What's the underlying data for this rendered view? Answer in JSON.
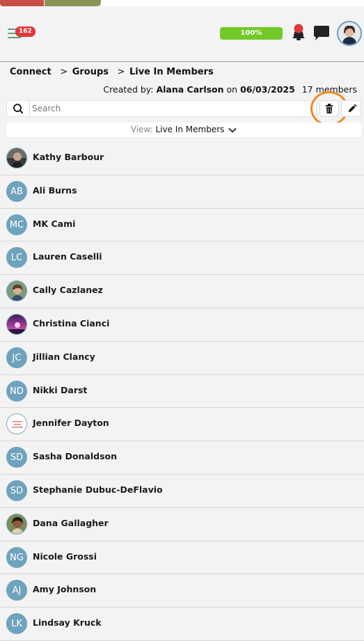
{
  "header": {
    "notification_count": "162",
    "progress_label": "100%",
    "progress_value": 1.0
  },
  "breadcrumb": {
    "items": [
      "Connect",
      "Groups",
      "Live In Members"
    ],
    "separator": ">"
  },
  "group_info": {
    "created_prefix": "Created by:",
    "creator": "Alana Carlson",
    "on_word": "on",
    "date": "06/03/2025",
    "member_count": "17 members"
  },
  "search": {
    "placeholder": "Search"
  },
  "view": {
    "label": "View:",
    "value": "Live In Members"
  },
  "members": [
    {
      "name": "Kathy Barbour",
      "initials": "",
      "avatar": "photo"
    },
    {
      "name": "Ali Burns",
      "initials": "AB",
      "avatar": "initials"
    },
    {
      "name": "MK Cami",
      "initials": "MC",
      "avatar": "initials"
    },
    {
      "name": "Lauren Caselli",
      "initials": "LC",
      "avatar": "initials"
    },
    {
      "name": "Cally Cazlanez",
      "initials": "",
      "avatar": "photo"
    },
    {
      "name": "Christina Cianci",
      "initials": "",
      "avatar": "photo"
    },
    {
      "name": "Jillian Clancy",
      "initials": "JC",
      "avatar": "initials"
    },
    {
      "name": "Nikki Darst",
      "initials": "ND",
      "avatar": "initials"
    },
    {
      "name": "Jennifer Dayton",
      "initials": "",
      "avatar": "logo"
    },
    {
      "name": "Sasha Donaldson",
      "initials": "SD",
      "avatar": "initials"
    },
    {
      "name": "Stephanie Dubuc-DeFlavio",
      "initials": "SD",
      "avatar": "initials"
    },
    {
      "name": "Dana Gallagher",
      "initials": "",
      "avatar": "photo"
    },
    {
      "name": "Nicole Grossi",
      "initials": "NG",
      "avatar": "initials"
    },
    {
      "name": "Amy Johnson",
      "initials": "AJ",
      "avatar": "initials"
    },
    {
      "name": "Lindsay Kruck",
      "initials": "LK",
      "avatar": "initials"
    }
  ],
  "colors": {
    "accent_green": "#72c928",
    "badge_red": "#e0383b",
    "avatar_blue": "#6fa3bd",
    "highlight_orange": "#f28a1f"
  },
  "icons": {
    "menu": "hamburger-icon",
    "bell": "bell-icon",
    "chat": "chat-icon",
    "search": "search-icon",
    "trash": "trash-icon",
    "edit": "pencil-icon",
    "view_toggle": "chevron-down-icon"
  }
}
